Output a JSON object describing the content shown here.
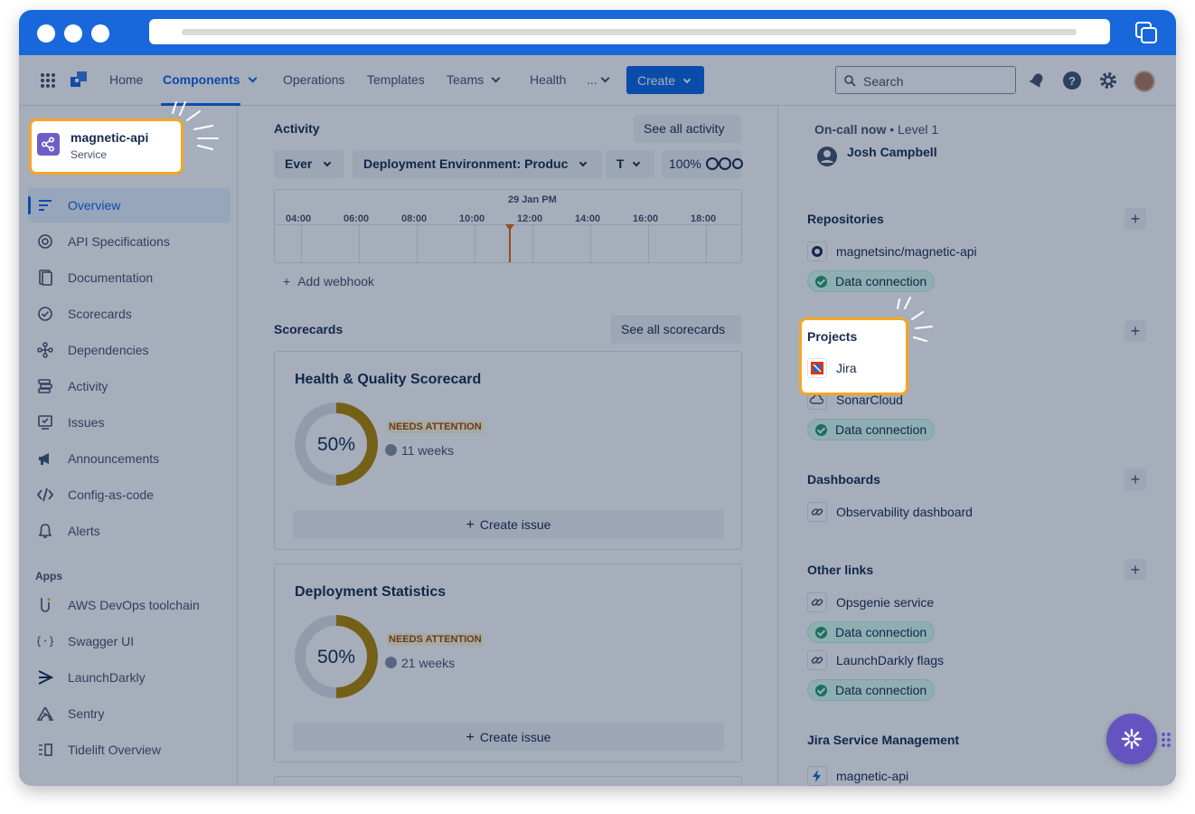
{
  "nav": {
    "home": "Home",
    "components": "Components",
    "operations": "Operations",
    "templates": "Templates",
    "teams": "Teams",
    "health": "Health",
    "more": "...",
    "create": "Create",
    "search_placeholder": "Search"
  },
  "service": {
    "name": "magnetic-api",
    "type": "Service"
  },
  "sidebar": {
    "items": [
      "Overview",
      "API Specifications",
      "Documentation",
      "Scorecards",
      "Dependencies",
      "Activity",
      "Issues",
      "Announcements",
      "Config-as-code",
      "Alerts"
    ],
    "apps_label": "Apps",
    "apps": [
      "AWS DevOps toolchain",
      "Swagger UI",
      "LaunchDarkly",
      "Sentry",
      "Tidelift Overview"
    ]
  },
  "activity": {
    "title": "Activity",
    "see_all": "See all activity",
    "filter_env": "Ever",
    "filter_deploy": "Deployment Environment: Produc",
    "filter_t": "T",
    "zoom": "100%",
    "date": "29 Jan PM",
    "ticks": [
      "04:00",
      "06:00",
      "08:00",
      "10:00",
      "12:00",
      "14:00",
      "16:00",
      "18:00"
    ],
    "add_webhook": "Add webhook"
  },
  "scorecards": {
    "title": "Scorecards",
    "see_all": "See all scorecards",
    "cards": [
      {
        "title": "Health & Quality Scorecard",
        "percent": "50%",
        "value": 50,
        "badge": "NEEDS ATTENTION",
        "age": "11 weeks",
        "action": "Create issue"
      },
      {
        "title": "Deployment Statistics",
        "percent": "50%",
        "value": 50,
        "badge": "NEEDS ATTENTION",
        "age": "21 weeks",
        "action": "Create issue"
      }
    ]
  },
  "right": {
    "oncall_label": "On-call now",
    "oncall_level": "Level 1",
    "oncall_person": "Josh Campbell",
    "repositories": "Repositories",
    "repo": "magnetsinc/magnetic-api",
    "data_connection": "Data connection",
    "projects": "Projects",
    "jira": "Jira",
    "sonar": "SonarCloud",
    "dashboards": "Dashboards",
    "observability": "Observability dashboard",
    "other_links": "Other links",
    "opsgenie": "Opsgenie service",
    "launchdarkly": "LaunchDarkly flags",
    "jsm": "Jira Service Management",
    "jsm_item": "magnetic-api"
  },
  "colors": {
    "accent": "#0c66e4",
    "highlight": "#f5a623",
    "donut": "#b38600"
  }
}
